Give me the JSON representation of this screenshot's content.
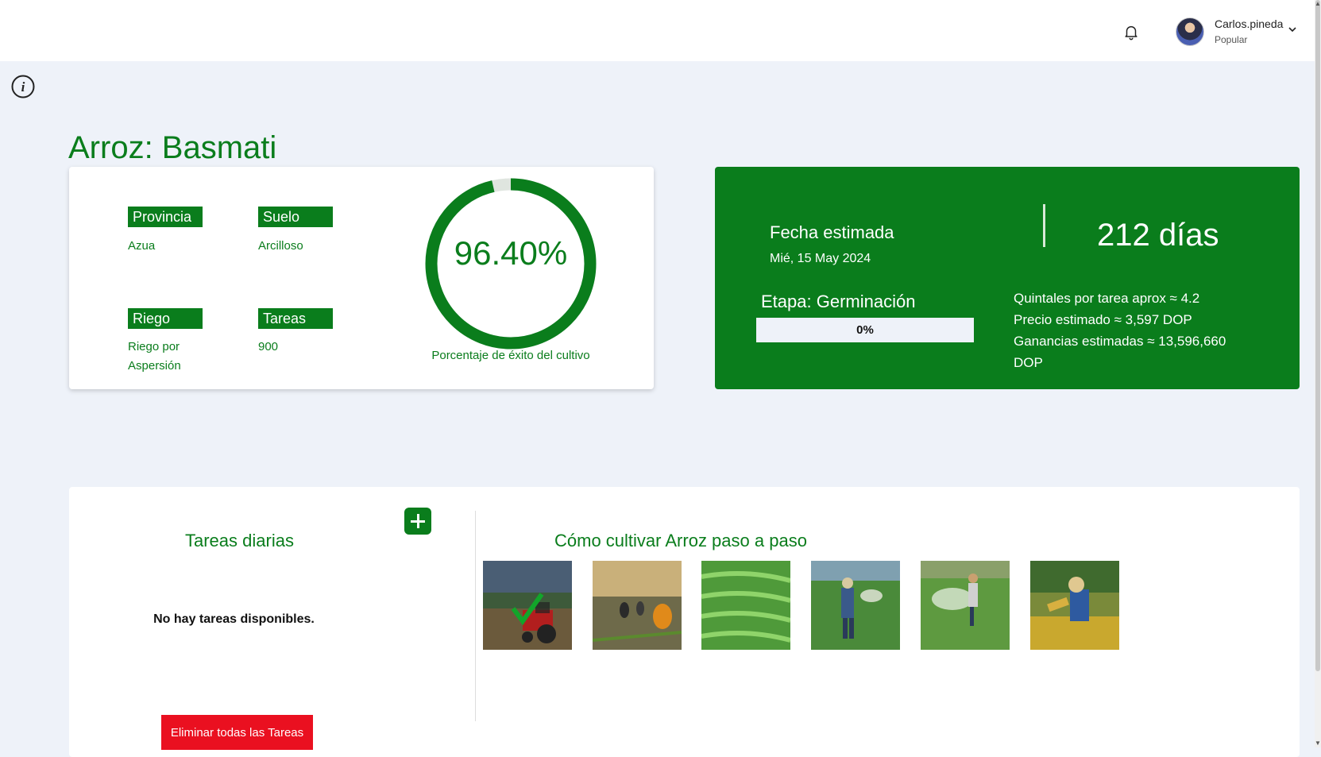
{
  "header": {
    "user_name": "Carlos.pineda",
    "user_role": "Popular"
  },
  "crop": {
    "title": "Arroz: Basmati"
  },
  "details": {
    "province_label": "Provincia",
    "province_value": "Azua",
    "soil_label": "Suelo",
    "soil_value": "Arcilloso",
    "irrigation_label": "Riego",
    "irrigation_value": "Riego por Aspersión",
    "tasks_label": "Tareas",
    "tasks_value": "900"
  },
  "success": {
    "percent_text": "96.40%",
    "percent": 96.4,
    "caption": "Porcentaje de éxito del cultivo"
  },
  "estimate": {
    "date_label": "Fecha estimada",
    "date_value": "Mié, 15 May 2024",
    "days": "212 días",
    "stage_label": "Etapa: Germinación",
    "stage_progress_text": "0%",
    "stage_progress": 0,
    "quintales": "Quintales por tarea aprox ≈ 4.2",
    "price": "Precio estimado ≈ 3,597 DOP",
    "profit": "Ganancias estimadas ≈ 13,596,660 DOP"
  },
  "tasks": {
    "title": "Tareas diarias",
    "empty_message": "No hay tareas disponibles.",
    "delete_all_label": "Eliminar todas las Tareas"
  },
  "howto": {
    "title": "Cómo cultivar Arroz paso a paso",
    "steps": [
      {
        "icon": "tractor-field-image",
        "completed": true
      },
      {
        "icon": "planting-workers-image",
        "completed": false
      },
      {
        "icon": "rice-paddy-image",
        "completed": false
      },
      {
        "icon": "fertilizing-farmer-image",
        "completed": false
      },
      {
        "icon": "spraying-farmer-image",
        "completed": false
      },
      {
        "icon": "harvesting-farmer-image",
        "completed": false
      }
    ]
  },
  "colors": {
    "brand_green": "#0a7d1c",
    "danger_red": "#ea1020",
    "background": "#eef2f9"
  }
}
